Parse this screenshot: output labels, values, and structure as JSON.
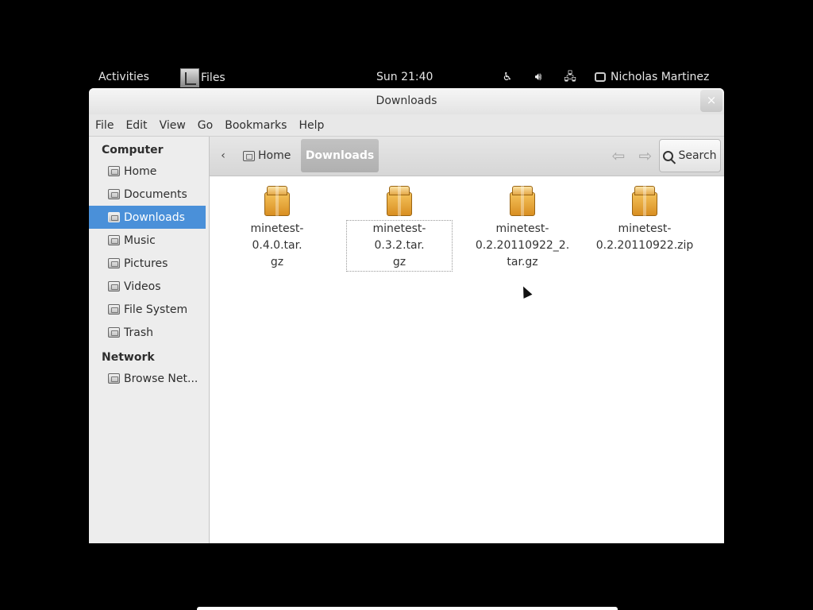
{
  "topbar": {
    "activities": "Activities",
    "app_menu": "Files",
    "clock": "Sun 21:40",
    "user": "Nicholas Martinez"
  },
  "window": {
    "title": "Downloads",
    "close_glyph": "×"
  },
  "menubar": [
    "File",
    "Edit",
    "View",
    "Go",
    "Bookmarks",
    "Help"
  ],
  "sidebar": {
    "computer_header": "Computer",
    "items": [
      {
        "label": "Home",
        "icon": "home-folder-icon"
      },
      {
        "label": "Documents",
        "icon": "documents-folder-icon"
      },
      {
        "label": "Downloads",
        "icon": "downloads-folder-icon",
        "selected": true
      },
      {
        "label": "Music",
        "icon": "music-folder-icon"
      },
      {
        "label": "Pictures",
        "icon": "pictures-folder-icon"
      },
      {
        "label": "Videos",
        "icon": "videos-folder-icon"
      },
      {
        "label": "File System",
        "icon": "drive-icon"
      },
      {
        "label": "Trash",
        "icon": "trash-icon"
      }
    ],
    "network_header": "Network",
    "network_items": [
      {
        "label": "Browse Net...",
        "icon": "network-computer-icon"
      }
    ]
  },
  "toolbar": {
    "path_back_glyph": "‹",
    "path_home": "Home",
    "path_current": "Downloads",
    "search_label": "Search"
  },
  "files": [
    {
      "line1": "minetest-0.4.0.tar.",
      "line2": "gz",
      "line3": ""
    },
    {
      "line1": "minetest-0.3.2.tar.",
      "line2": "gz",
      "line3": ""
    },
    {
      "line1": "minetest-",
      "line2": "0.2.20110922_2.",
      "line3": "tar.gz"
    },
    {
      "line1": "minetest-",
      "line2": "0.2.20110922.zip",
      "line3": ""
    }
  ],
  "colors": {
    "selection": "#4a90d9",
    "package_icon": "#e8a43a"
  }
}
